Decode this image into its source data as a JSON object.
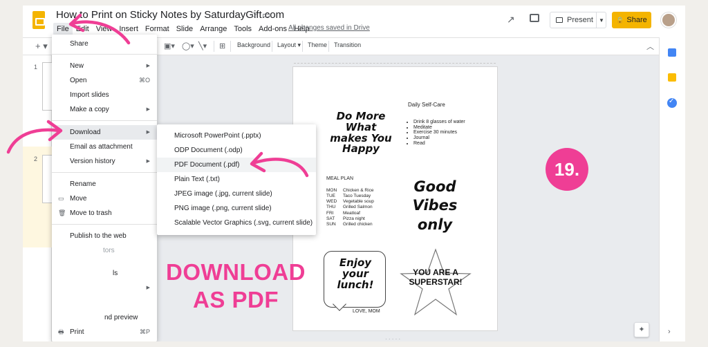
{
  "app": {
    "title": "How to Print on Sticky Notes by SaturdayGift.com",
    "saved_status": "All changes saved in Drive",
    "menubar": [
      "File",
      "Edit",
      "View",
      "Insert",
      "Format",
      "Slide",
      "Arrange",
      "Tools",
      "Add-ons",
      "Help"
    ],
    "present_label": "Present",
    "share_label": "Share"
  },
  "toolbar": {
    "items": [
      "Background",
      "Layout",
      "Theme",
      "Transition"
    ]
  },
  "filmstrip": {
    "slides": [
      "1",
      "2"
    ]
  },
  "file_menu": {
    "items": [
      {
        "label": "Share"
      },
      {
        "label": "New"
      },
      {
        "label": "Open",
        "shortcut": "⌘O"
      },
      {
        "label": "Import slides"
      },
      {
        "label": "Make a copy"
      },
      {
        "label": "Download"
      },
      {
        "label": "Email as attachment"
      },
      {
        "label": "Version history"
      },
      {
        "label": "Rename"
      },
      {
        "label": "Move"
      },
      {
        "label": "Move to trash"
      },
      {
        "label": "Publish to the web"
      },
      {
        "label": "tors"
      },
      {
        "label": "ls"
      },
      {
        "label": "nd preview"
      },
      {
        "label": "Print",
        "shortcut": "⌘P"
      }
    ]
  },
  "download_menu": {
    "items": [
      "Microsoft PowerPoint (.pptx)",
      "ODP Document (.odp)",
      "PDF Document (.pdf)",
      "Plain Text (.txt)",
      "JPEG image (.jpg, current slide)",
      "PNG image (.png, current slide)",
      "Scalable Vector Graphics (.svg, current slide)"
    ]
  },
  "slide": {
    "note_domore": "Do More What makes You Happy",
    "selfcare_title": "Daily Self-Care",
    "selfcare_items": [
      "Drink 8 glasses of water",
      "Meditate",
      "Exercise 30 minutes",
      "Journal",
      "Read"
    ],
    "meal_title": "MEAL PLAN",
    "meals": [
      {
        "day": "MON",
        "meal": "Chicken & Rice"
      },
      {
        "day": "TUE",
        "meal": "Taco Tuesday"
      },
      {
        "day": "WED",
        "meal": "Vegetable soup"
      },
      {
        "day": "THU",
        "meal": "Grilled Salmon"
      },
      {
        "day": "FRI",
        "meal": "Meatloaf"
      },
      {
        "day": "SAT",
        "meal": "Pizza night"
      },
      {
        "day": "SUN",
        "meal": "Grilled chicken"
      }
    ],
    "note_goodvibes": "Good Vibes only",
    "note_lunch": "Enjoy your lunch!",
    "note_love": "LOVE, MOM",
    "note_superstar": "YOU ARE A SUPERSTAR!"
  },
  "annotations": {
    "step_badge": "19.",
    "overlay_line1": "DOWNLOAD",
    "overlay_line2": "AS PDF",
    "accent_color": "#ef3e95"
  },
  "icons": [
    "slides-logo-icon",
    "star-icon",
    "folder-icon",
    "trend-icon",
    "comment-icon",
    "lock-icon",
    "calendar-icon",
    "keep-icon",
    "tasks-icon"
  ]
}
